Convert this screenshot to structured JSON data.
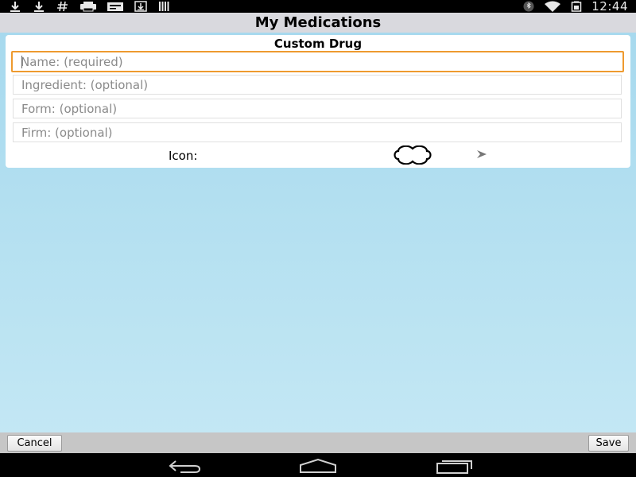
{
  "status_bar": {
    "time": "12:44",
    "left_icons": [
      "download-icon",
      "download-icon",
      "hash-icon",
      "printer-icon",
      "card-icon",
      "download-box-icon",
      "barcode-icon"
    ],
    "right_icons": [
      "bluetooth-icon",
      "wifi-icon",
      "battery-icon"
    ]
  },
  "app_bar": {
    "title": "My Medications"
  },
  "form": {
    "title": "Custom Drug",
    "name_placeholder": "Name: (required)",
    "ingredient_placeholder": "Ingredient: (optional)",
    "form_placeholder": "Form: (optional)",
    "firm_placeholder": "Firm: (optional)",
    "icon_label": "Icon:",
    "icon_name": "pill-outline-icon",
    "focused_field": "name",
    "accent_color": "#ee9a2f"
  },
  "bottom_bar": {
    "cancel_label": "Cancel",
    "save_label": "Save"
  },
  "nav_bar": {
    "icons": [
      "back-icon",
      "home-icon",
      "recents-icon"
    ]
  }
}
